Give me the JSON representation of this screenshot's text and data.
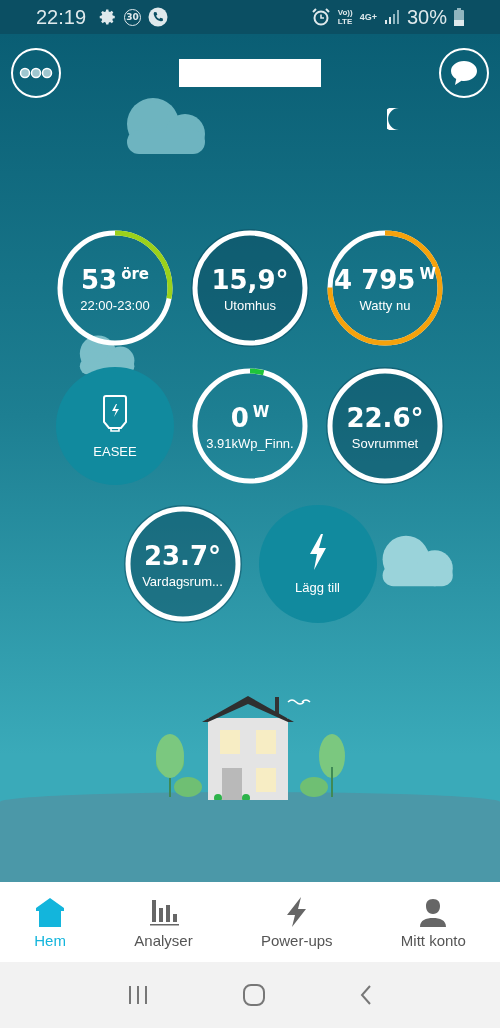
{
  "status_bar": {
    "time": "22:19",
    "notification_badge": "30",
    "volte_top": "Vo))",
    "volte_bottom": "LTE",
    "network": "4G+",
    "battery": "30%"
  },
  "tiles": [
    {
      "kind": "ring",
      "value": "53",
      "unit": "öre",
      "label": "22:00-23:00",
      "level": 0.28,
      "color": "#9bd11a"
    },
    {
      "kind": "ring",
      "value": "15,9°",
      "label": "Utomhus"
    },
    {
      "kind": "ring",
      "value": "4 795",
      "unit": "W",
      "label": "Watty nu",
      "level": 0.75,
      "color": "#f5a20c"
    },
    {
      "kind": "device",
      "label": "EASEE"
    },
    {
      "kind": "ring",
      "value": "0",
      "unit": "W",
      "label": "3.91kWp_Finn.",
      "level": 0.04,
      "color": "#1fc43a"
    },
    {
      "kind": "ring",
      "value": "22.6°",
      "label": "Sovrummet"
    },
    {
      "kind": "ring",
      "value": "23.7°",
      "label": "Vardagsrum..."
    },
    {
      "kind": "add",
      "label": "Lägg till"
    }
  ],
  "tabs": [
    {
      "label": "Hem",
      "selected": true
    },
    {
      "label": "Analyser",
      "selected": false
    },
    {
      "label": "Power-ups",
      "selected": false
    },
    {
      "label": "Mitt konto",
      "selected": false
    }
  ]
}
